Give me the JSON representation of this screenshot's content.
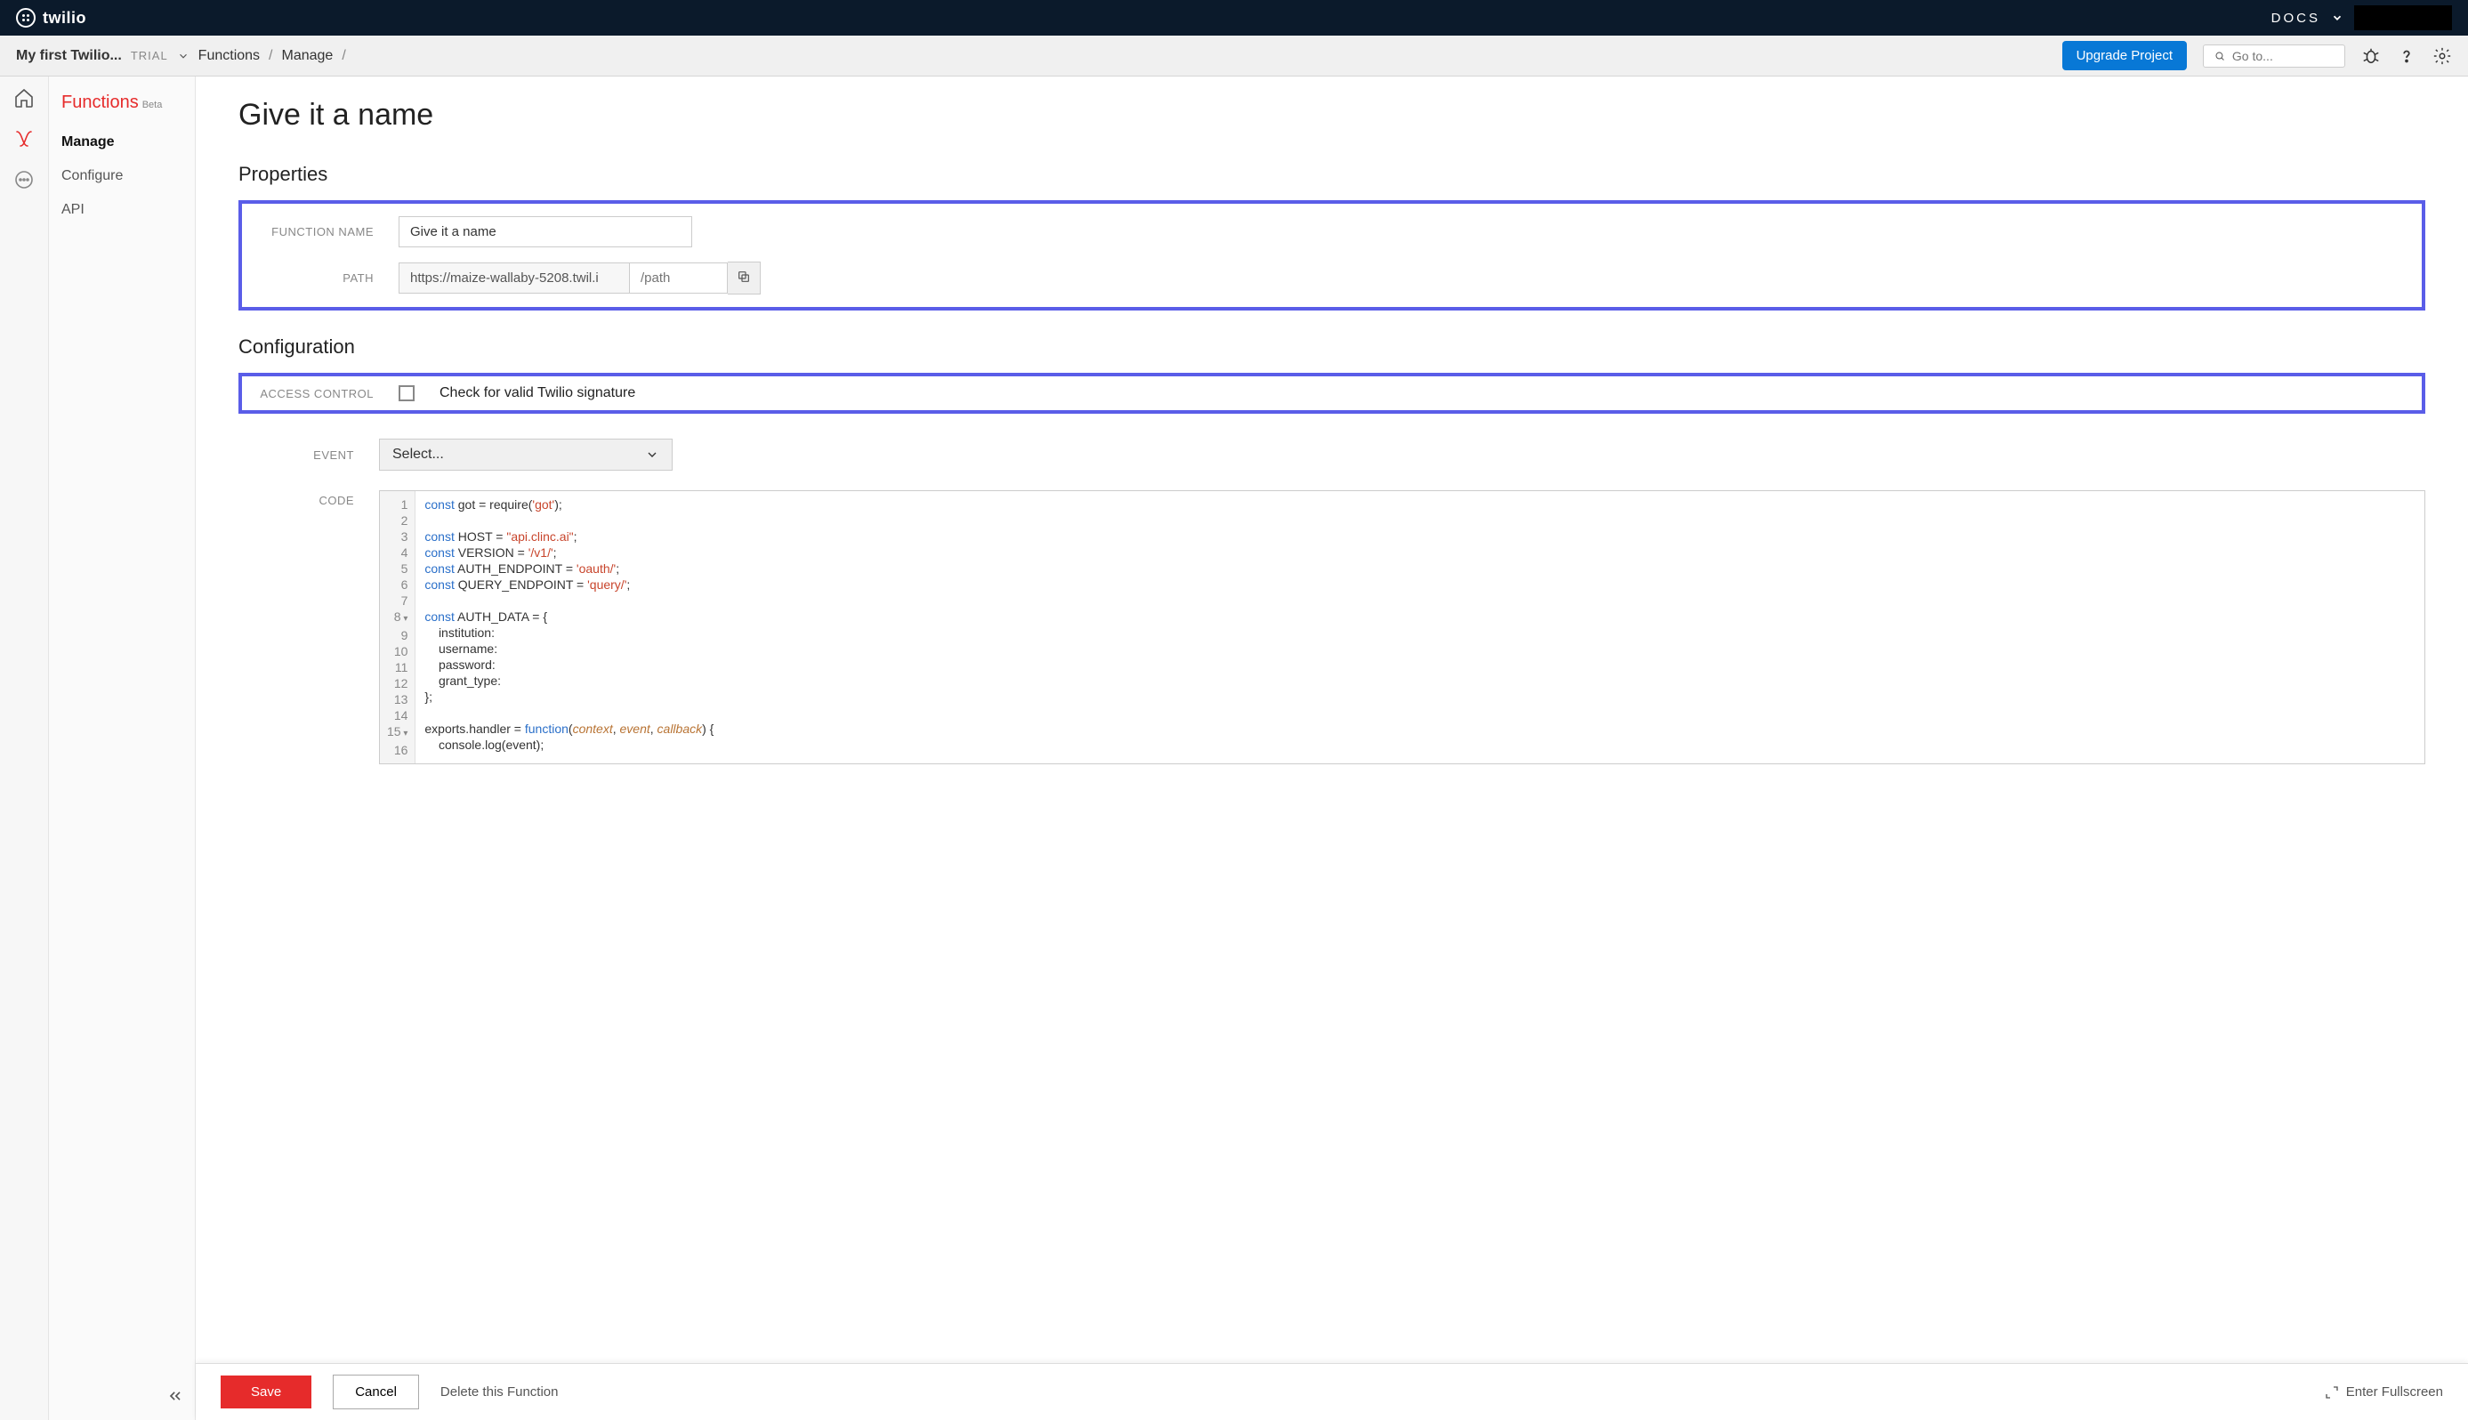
{
  "topbar": {
    "brand": "twilio",
    "docs_label": "DOCS"
  },
  "subbar": {
    "project_name": "My first Twilio...",
    "trial_label": "TRIAL",
    "crumb1": "Functions",
    "crumb2": "Manage",
    "upgrade_label": "Upgrade Project",
    "search_placeholder": "Go to..."
  },
  "sidenav": {
    "title": "Functions",
    "beta": "Beta",
    "items": [
      "Manage",
      "Configure",
      "API"
    ]
  },
  "page": {
    "title": "Give it a name",
    "properties_heading": "Properties",
    "config_heading": "Configuration",
    "labels": {
      "function_name": "FUNCTION NAME",
      "path": "PATH",
      "access_control": "ACCESS CONTROL",
      "event": "EVENT",
      "code": "CODE"
    },
    "function_name_value": "Give it a name",
    "path_base": "https://maize-wallaby-5208.twil.i",
    "path_placeholder": "/path",
    "access_control_text": "Check for valid Twilio signature",
    "event_select": "Select..."
  },
  "code_lines": [
    {
      "n": "1",
      "html": "<span class='kw'>const</span> got = require(<span class='str'>'got'</span>);"
    },
    {
      "n": "2",
      "html": ""
    },
    {
      "n": "3",
      "html": "<span class='kw'>const</span> HOST = <span class='str'>\"api.clinc.ai\"</span>;"
    },
    {
      "n": "4",
      "html": "<span class='kw'>const</span> VERSION = <span class='str'>'/v1/'</span>;"
    },
    {
      "n": "5",
      "html": "<span class='kw'>const</span> AUTH_ENDPOINT = <span class='str'>'oauth/'</span>;"
    },
    {
      "n": "6",
      "html": "<span class='kw'>const</span> QUERY_ENDPOINT = <span class='str'>'query/'</span>;"
    },
    {
      "n": "7",
      "html": ""
    },
    {
      "n": "8",
      "fold": true,
      "html": "<span class='kw'>const</span> AUTH_DATA = {"
    },
    {
      "n": "9",
      "html": "    institution:"
    },
    {
      "n": "10",
      "html": "    username:"
    },
    {
      "n": "11",
      "html": "    password:"
    },
    {
      "n": "12",
      "html": "    grant_type:"
    },
    {
      "n": "13",
      "html": "};"
    },
    {
      "n": "14",
      "html": ""
    },
    {
      "n": "15",
      "fold": true,
      "html": "exports.handler = <span class='kw'>function</span>(<span class='arg'>context</span>, <span class='arg'>event</span>, <span class='arg'>callback</span>) {"
    },
    {
      "n": "16",
      "html": "    console.log(event);"
    }
  ],
  "footer": {
    "save": "Save",
    "cancel": "Cancel",
    "delete": "Delete this Function",
    "fullscreen": "Enter Fullscreen"
  }
}
